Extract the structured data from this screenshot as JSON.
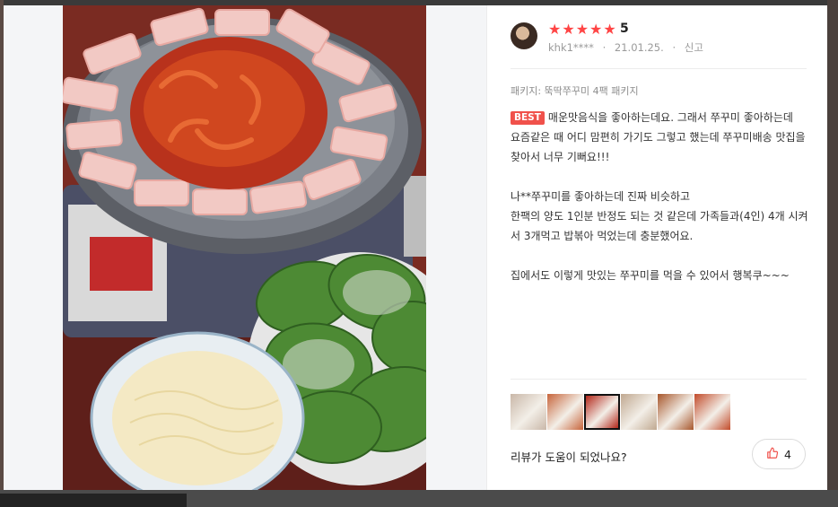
{
  "review": {
    "rating": "5",
    "stars": 5,
    "reviewer": "khk1****",
    "date": "21.01.25.",
    "separator": "·",
    "report_label": "신고",
    "package_line": "패키지: 뚝딱쭈꾸미 4팩 패키지",
    "badge": "BEST",
    "paragraphs": [
      "매운맛음식을 좋아하는데요. 그래서 쭈꾸미 좋아하는데\n요즘같은 때 어디 맘편히 가기도 그렇고 했는데 쭈꾸미배송 맛집을 찾아서 너무 기뻐요!!!",
      "나**쭈꾸미를 좋아하는데 진짜 비슷하고\n한팩의 양도 1인분 반정도 되는 것 같은데 가족들과(4인) 4개 시켜서 3개먹고 밥볶아 먹었는데 충분했어요.",
      "집에서도 이렇게 맛있는 쭈꾸미를 먹을 수 있어서 행복쿠~~~"
    ],
    "helpful_question": "리뷰가 도움이 되었나요?",
    "helpful_count": "4"
  },
  "thumbnails": [
    {
      "name": "thumb-1",
      "color": "#c9b7a8"
    },
    {
      "name": "thumb-2",
      "color": "#c7643a"
    },
    {
      "name": "thumb-3",
      "color": "#b3271a",
      "active": true
    },
    {
      "name": "thumb-4",
      "color": "#c0a890"
    },
    {
      "name": "thumb-5",
      "color": "#a7562b"
    },
    {
      "name": "thumb-6",
      "color": "#c24b2a"
    }
  ],
  "colors": {
    "star": "#ff4545",
    "badge": "#f0514b",
    "thumb_up": "#f0514b"
  },
  "icons": {
    "star": "★",
    "thumb_up": "thumb-up-icon"
  }
}
